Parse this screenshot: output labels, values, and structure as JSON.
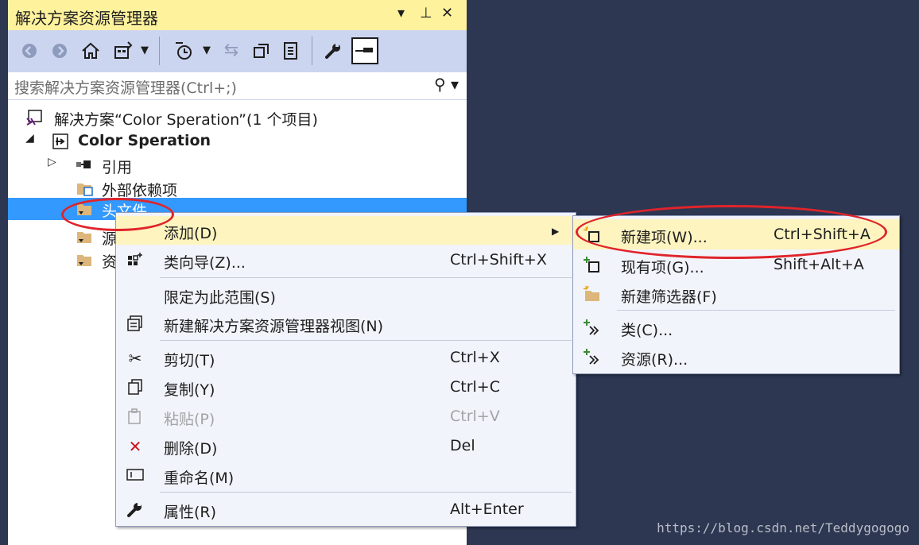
{
  "panel": {
    "title": "解决方案资源管理器",
    "title_buttons": [
      "▾",
      "⊥",
      "✕"
    ],
    "search_placeholder": "搜索解决方案资源管理器(Ctrl+;)"
  },
  "toolbar": {
    "icons": [
      "back-icon",
      "forward-icon",
      "home-icon",
      "switch-views-icon",
      "dropdown-icon",
      "pending-changes-filter-icon",
      "dropdown-icon",
      "sync-icon",
      "collapse-all-icon",
      "show-all-files-icon",
      "properties-icon",
      "preview-selected-icon"
    ]
  },
  "tree": {
    "solution": "解决方案“Color Speration”(1 个项目)",
    "project": "Color Speration",
    "references": "引用",
    "external_deps": "外部依赖项",
    "headers": "头文件",
    "source": "源",
    "resources": "资"
  },
  "context_menu": {
    "items": [
      {
        "label": "添加(D)",
        "shortcut": "",
        "icon": "none"
      },
      {
        "label": "类向导(Z)...",
        "shortcut": "Ctrl+Shift+X",
        "icon": "class-wizard-icon"
      },
      {
        "label": "限定为此范围(S)",
        "shortcut": "",
        "icon": "none"
      },
      {
        "label": "新建解决方案资源管理器视图(N)",
        "shortcut": "",
        "icon": "new-view-icon"
      },
      {
        "label": "剪切(T)",
        "shortcut": "Ctrl+X",
        "icon": "cut-icon"
      },
      {
        "label": "复制(Y)",
        "shortcut": "Ctrl+C",
        "icon": "copy-icon"
      },
      {
        "label": "粘贴(P)",
        "shortcut": "Ctrl+V",
        "icon": "paste-icon"
      },
      {
        "label": "删除(D)",
        "shortcut": "Del",
        "icon": "delete-icon"
      },
      {
        "label": "重命名(M)",
        "shortcut": "",
        "icon": "rename-icon"
      },
      {
        "label": "属性(R)",
        "shortcut": "Alt+Enter",
        "icon": "wrench-icon"
      }
    ]
  },
  "submenu": {
    "items": [
      {
        "label": "新建项(W)...",
        "shortcut": "Ctrl+Shift+A"
      },
      {
        "label": "现有项(G)...",
        "shortcut": "Shift+Alt+A"
      },
      {
        "label": "新建筛选器(F)",
        "shortcut": ""
      },
      {
        "label": "类(C)...",
        "shortcut": ""
      },
      {
        "label": "资源(R)...",
        "shortcut": ""
      }
    ]
  },
  "watermark": "https://blog.csdn.net/Teddygogogo",
  "colors": {
    "background": "#2d3752",
    "titlebar": "#fff29d",
    "toolbar": "#ccd5f0",
    "selection": "#3399ff",
    "menu_hover": "#fdf4bf",
    "annotation": "#e0242a"
  }
}
